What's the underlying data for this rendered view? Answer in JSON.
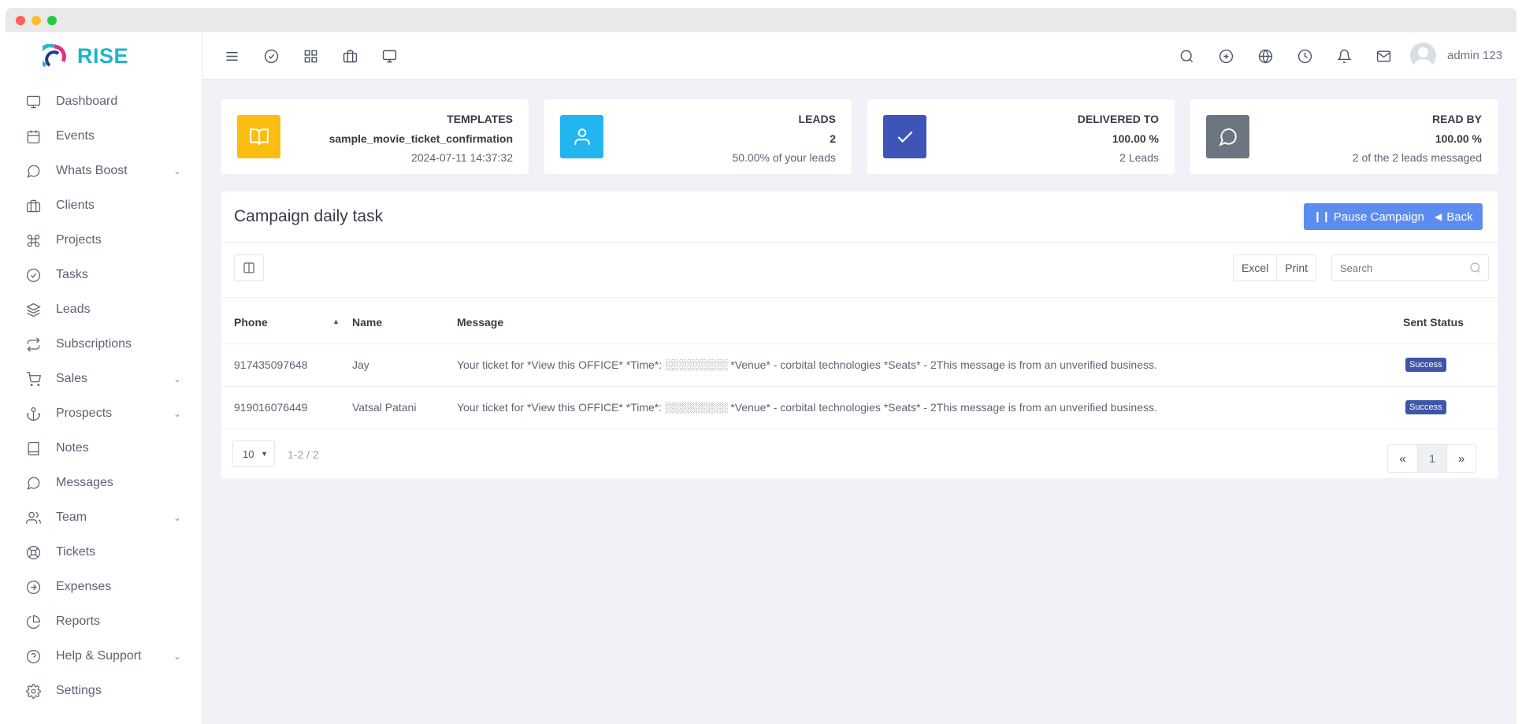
{
  "app": {
    "name": "RISE"
  },
  "sidebar": {
    "items": [
      {
        "label": "Dashboard",
        "icon": "monitor-icon",
        "has_submenu": false
      },
      {
        "label": "Events",
        "icon": "calendar-icon",
        "has_submenu": false
      },
      {
        "label": "Whats Boost",
        "icon": "chat-icon",
        "has_submenu": true
      },
      {
        "label": "Clients",
        "icon": "briefcase-icon",
        "has_submenu": false
      },
      {
        "label": "Projects",
        "icon": "command-icon",
        "has_submenu": false
      },
      {
        "label": "Tasks",
        "icon": "check-circle-icon",
        "has_submenu": false
      },
      {
        "label": "Leads",
        "icon": "layers-icon",
        "has_submenu": false
      },
      {
        "label": "Subscriptions",
        "icon": "repeat-icon",
        "has_submenu": false
      },
      {
        "label": "Sales",
        "icon": "cart-icon",
        "has_submenu": true
      },
      {
        "label": "Prospects",
        "icon": "anchor-icon",
        "has_submenu": true
      },
      {
        "label": "Notes",
        "icon": "book-icon",
        "has_submenu": false
      },
      {
        "label": "Messages",
        "icon": "message-icon",
        "has_submenu": false
      },
      {
        "label": "Team",
        "icon": "users-icon",
        "has_submenu": true
      },
      {
        "label": "Tickets",
        "icon": "life-buoy-icon",
        "has_submenu": false
      },
      {
        "label": "Expenses",
        "icon": "arrow-circle-icon",
        "has_submenu": false
      },
      {
        "label": "Reports",
        "icon": "pie-chart-icon",
        "has_submenu": false
      },
      {
        "label": "Help & Support",
        "icon": "help-circle-icon",
        "has_submenu": true
      },
      {
        "label": "Settings",
        "icon": "gear-icon",
        "has_submenu": false
      }
    ]
  },
  "topbar": {
    "left_icons": [
      "menu-icon",
      "check-circle-icon",
      "grid-icon",
      "briefcase-icon",
      "monitor-icon"
    ],
    "right_icons": [
      "search-icon",
      "plus-circle-icon",
      "globe-icon",
      "clock-icon",
      "bell-icon",
      "mail-icon"
    ],
    "user_name": "admin 123"
  },
  "cards": [
    {
      "label": "TEMPLATES",
      "value": "sample_movie_ticket_confirmation",
      "sub": "2024-07-11 14:37:32",
      "icon": "book-open-icon",
      "color": "#fbbd12"
    },
    {
      "label": "LEADS",
      "value": "2",
      "sub": "50.00% of your leads",
      "icon": "user-icon",
      "color": "#22b5f0"
    },
    {
      "label": "DELIVERED TO",
      "value": "100.00 %",
      "sub": "2 Leads",
      "icon": "check-icon",
      "color": "#3e55b8"
    },
    {
      "label": "READ BY",
      "value": "100.00 %",
      "sub": "2 of the 2 leads messaged",
      "icon": "message-circle-icon",
      "color": "#6c7580"
    }
  ],
  "panel": {
    "title": "Campaign daily task",
    "pause_label": "Pause Campaign",
    "back_label": "Back",
    "excel_label": "Excel",
    "print_label": "Print",
    "search_placeholder": "Search"
  },
  "table": {
    "headers": {
      "phone": "Phone",
      "name": "Name",
      "message": "Message",
      "status": "Sent Status"
    },
    "rows": [
      {
        "phone": "917435097648",
        "name": "Jay",
        "message": "Your ticket for *View this OFFICE* *Time*: ░░░░░░░░ *Venue* - corbital technologies *Seats* - 2This message is from an unverified business.",
        "status": "Success"
      },
      {
        "phone": "919016076449",
        "name": "Vatsal Patani",
        "message": "Your ticket for *View this OFFICE* *Time*: ░░░░░░░░ *Venue* - corbital technologies *Seats* - 2This message is from an unverified business.",
        "status": "Success"
      }
    ]
  },
  "pagination": {
    "page_size": "10",
    "info": "1-2 / 2",
    "prev": "«",
    "current": "1",
    "next": "»"
  }
}
